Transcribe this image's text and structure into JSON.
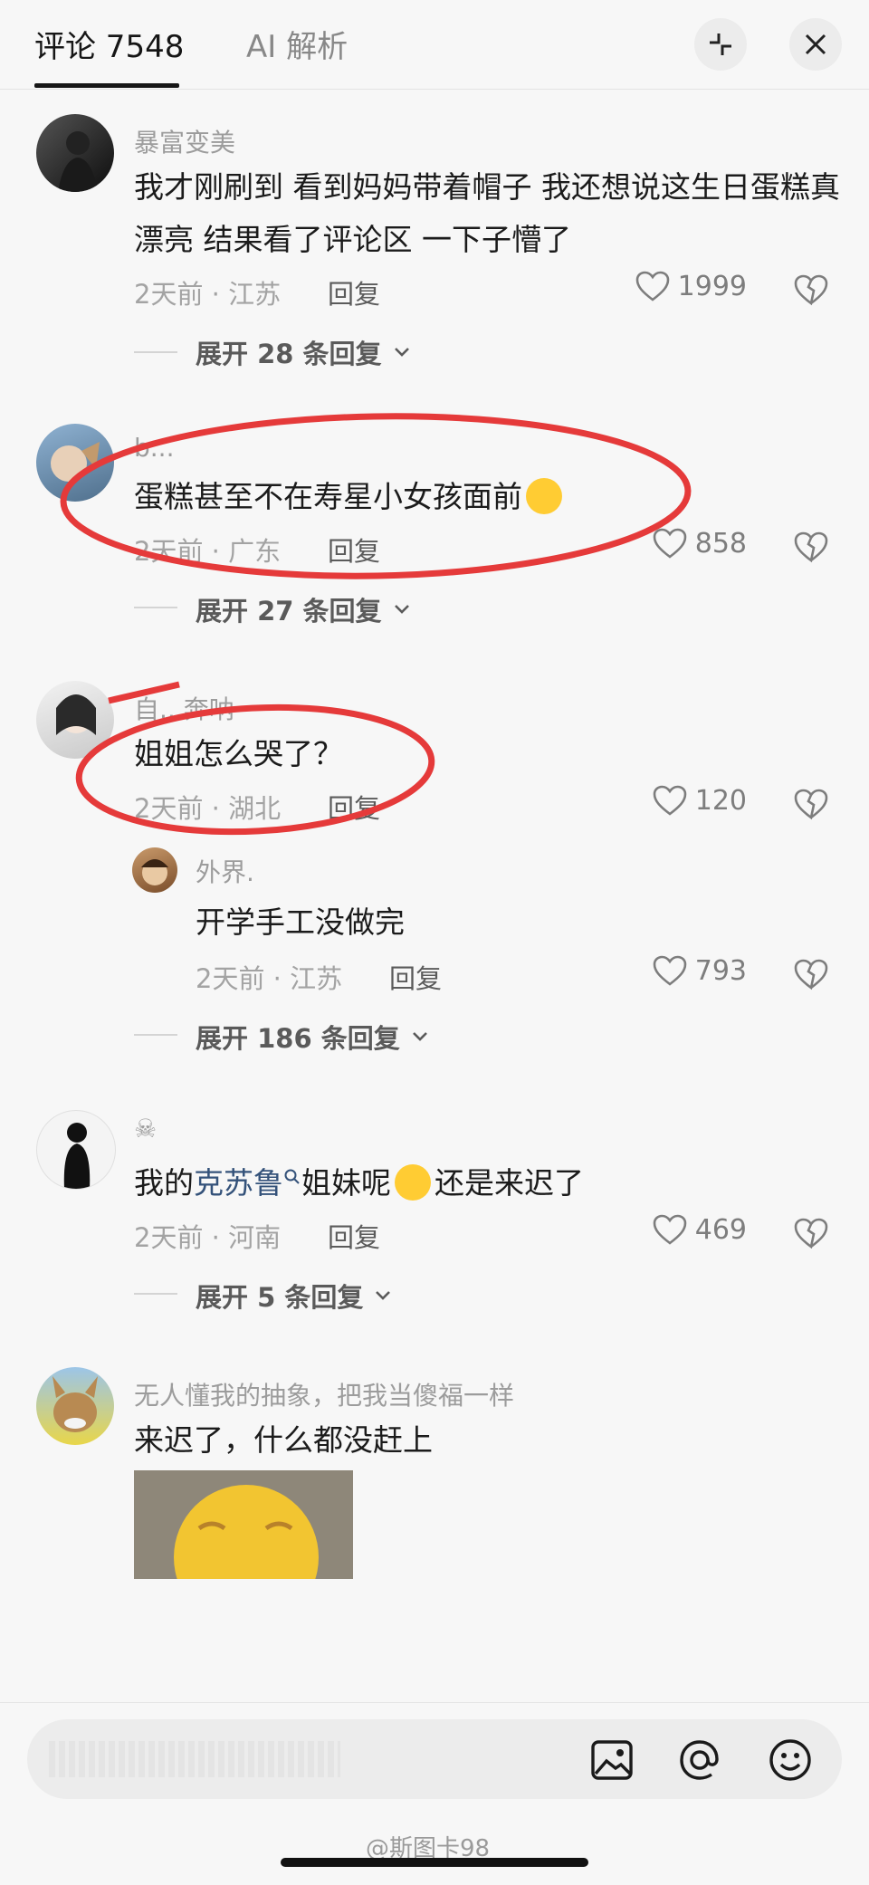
{
  "header": {
    "tab_comments": "评论 7548",
    "tab_ai": "AI 解析",
    "collapse_icon": "collapse-icon",
    "close_icon": "close-icon"
  },
  "comments": [
    {
      "username": "暴富变美",
      "text": "我才刚刷到 看到妈妈带着帽子 我还想说这生日蛋糕真漂亮  结果看了评论区 一下子懵了",
      "meta": "2天前 · 江苏",
      "reply": "回复",
      "likes": "1999",
      "expand": "展开 28 条回复"
    },
    {
      "username": "b...",
      "text": "蛋糕甚至不在寿星小女孩面前",
      "meta": "2天前 · 广东",
      "reply": "回复",
      "likes": "858",
      "expand": "展开 27 条回复"
    },
    {
      "username": "自...奔呐",
      "text": "姐姐怎么哭了？",
      "meta": "2天前 · 湖北",
      "reply": "回复",
      "likes": "120",
      "subreply": {
        "username": "外界.",
        "text": "开学手工没做完",
        "meta": "2天前 · 江苏",
        "reply": "回复",
        "likes": "793"
      },
      "expand": "展开 186 条回复"
    },
    {
      "username": "☠",
      "text_prefix": "我的",
      "text_link": "克苏鲁",
      "text_mid": "姐妹呢",
      "text_suffix": "还是来迟了",
      "meta": "2天前 · 河南",
      "reply": "回复",
      "likes": "469",
      "expand": "展开 5 条回复"
    },
    {
      "username": "无人懂我的抽象，把我当傻福一样",
      "text": "来迟了，什么都没赶上"
    }
  ],
  "bottom": {
    "placeholder": "",
    "watermark": "@斯图卡98"
  },
  "colors": {
    "annotation_red": "#e53a3a",
    "link": "#34527a"
  }
}
